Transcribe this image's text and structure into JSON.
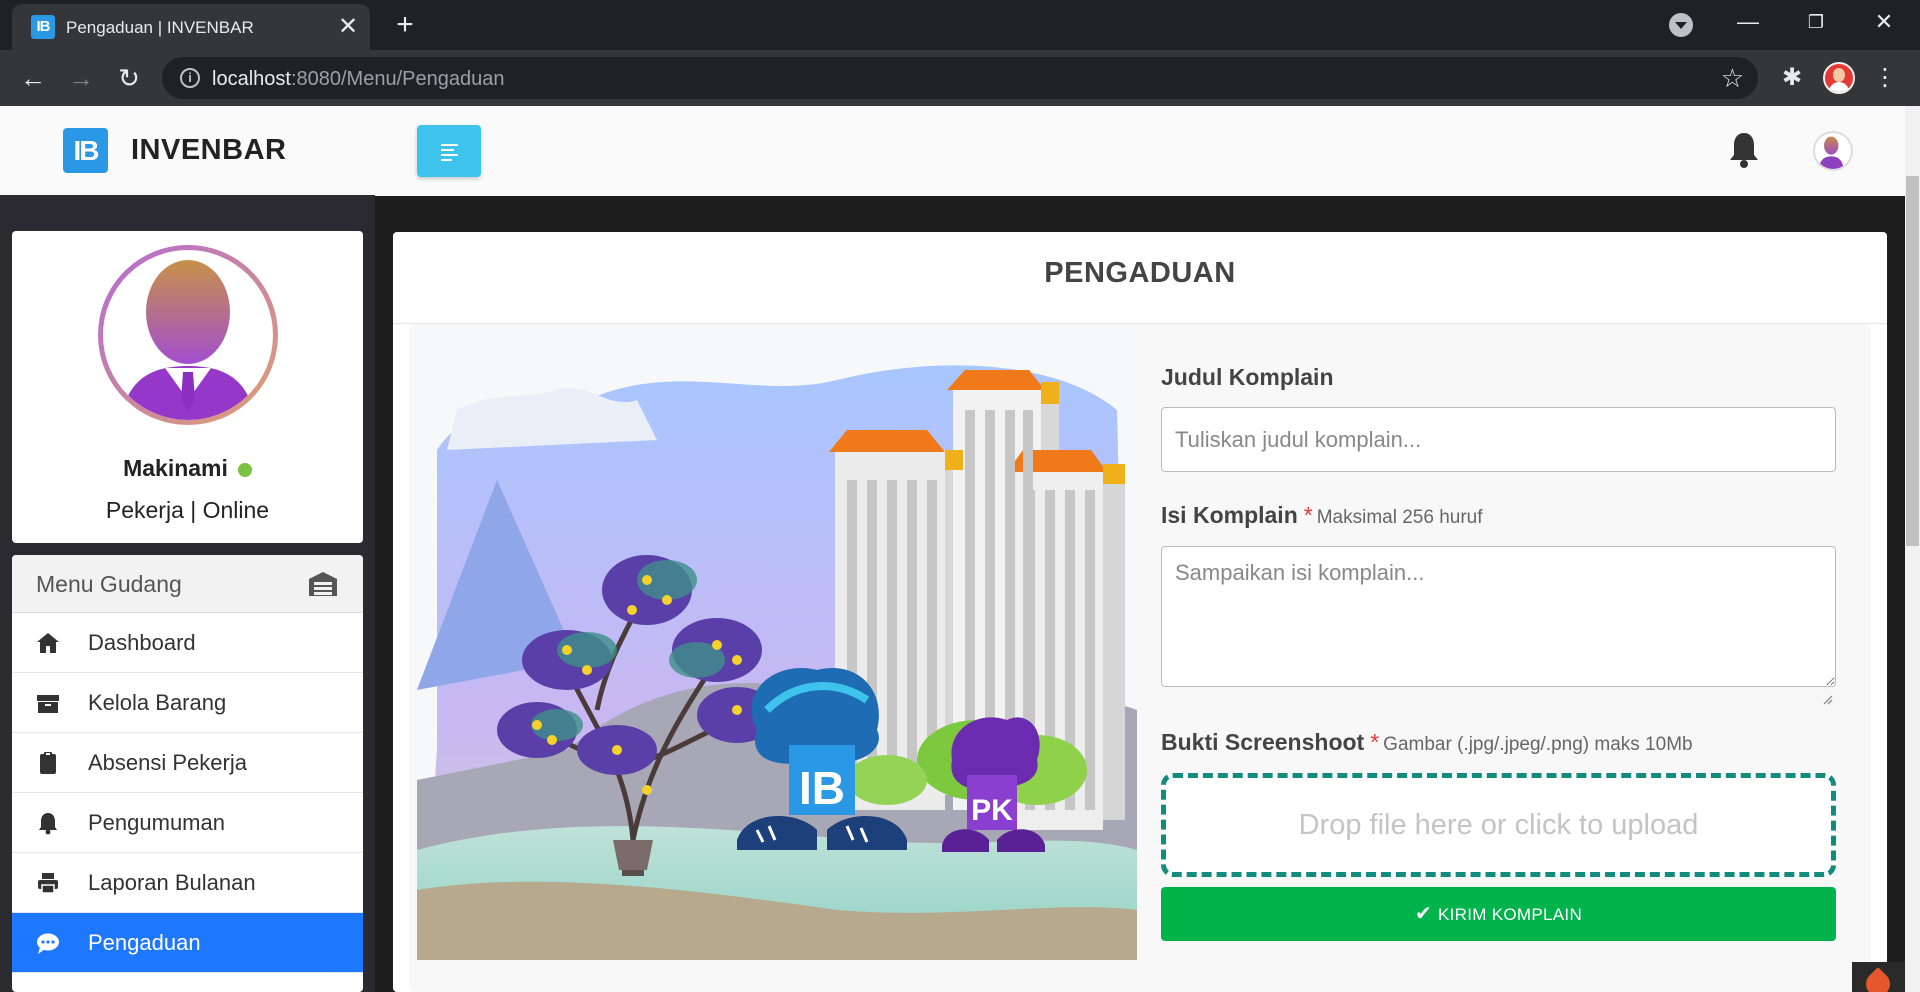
{
  "browser": {
    "tab_title": "Pengaduan | INVENBAR",
    "favicon_text": "IB",
    "url_host": "localhost",
    "url_path": ":8080/Menu/Pengaduan"
  },
  "brand": {
    "logo_text": "IB",
    "name": "INVENBAR"
  },
  "user": {
    "name": "Makinami",
    "role_status": "Pekerja | Online",
    "status_color": "#7cc242"
  },
  "menu": {
    "title": "Menu Gudang",
    "items": [
      {
        "label": "Dashboard",
        "icon": "home-icon"
      },
      {
        "label": "Kelola Barang",
        "icon": "box-icon"
      },
      {
        "label": "Absensi Pekerja",
        "icon": "clipboard-icon"
      },
      {
        "label": "Pengumuman",
        "icon": "bell-icon"
      },
      {
        "label": "Laporan Bulanan",
        "icon": "printer-icon"
      },
      {
        "label": "Pengaduan",
        "icon": "chat-icon",
        "active": true
      }
    ]
  },
  "page": {
    "title": "PENGADUAN",
    "illustration_badges": [
      "IB",
      "PK"
    ]
  },
  "form": {
    "judul": {
      "label": "Judul Komplain",
      "placeholder": "Tuliskan judul komplain...",
      "value": ""
    },
    "isi": {
      "label": "Isi Komplain",
      "required_mark": "*",
      "hint": "Maksimal 256 huruf",
      "placeholder": "Sampaikan isi komplain...",
      "value": ""
    },
    "bukti": {
      "label": "Bukti Screenshoot",
      "required_mark": "*",
      "hint": "Gambar (.jpg/.jpeg/.png) maks 10Mb",
      "dropzone_text": "Drop file here or click to upload"
    },
    "submit_label": "KIRIM KOMPLAIN"
  },
  "colors": {
    "accent_toggle": "#3ec3ec",
    "active_menu": "#1e78ff",
    "submit": "#00b34b",
    "dropzone_border": "#128c7e"
  }
}
